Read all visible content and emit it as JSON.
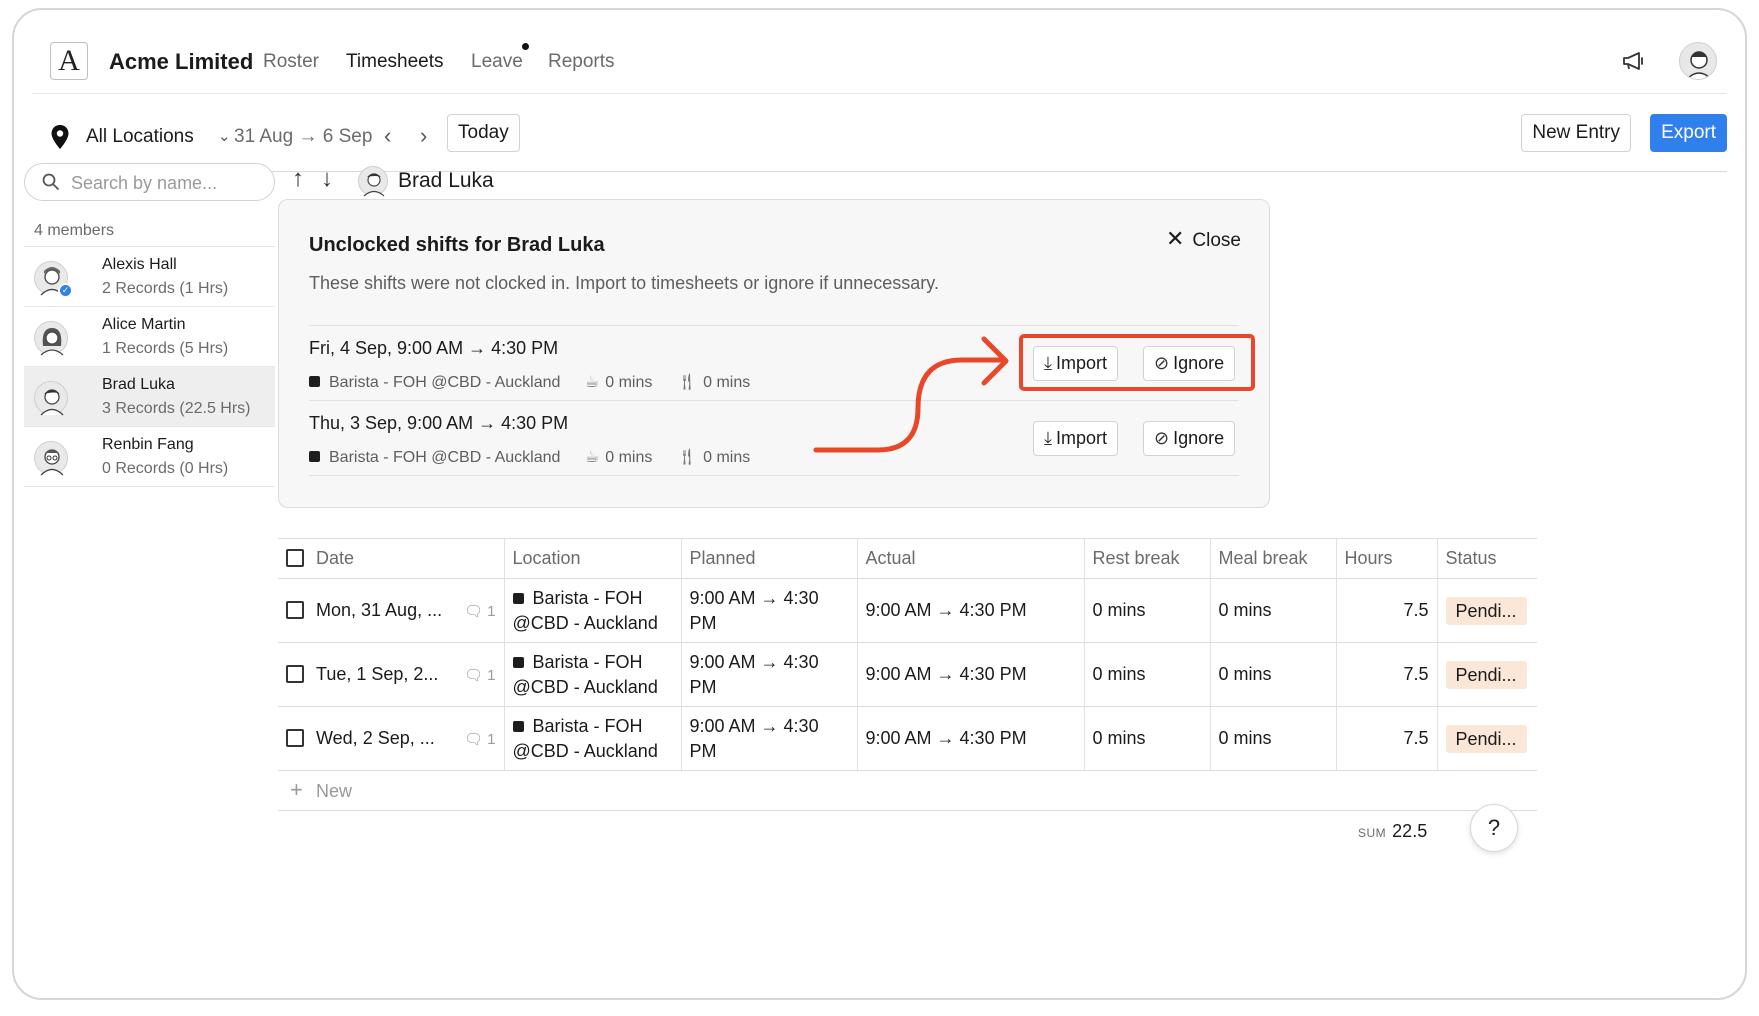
{
  "app": {
    "company": "Acme Limited",
    "logo_letter": "A"
  },
  "nav": {
    "items": [
      {
        "label": "Roster"
      },
      {
        "label": "Timesheets"
      },
      {
        "label": "Leave"
      },
      {
        "label": "Reports"
      }
    ],
    "active": "Timesheets"
  },
  "toolbar": {
    "location": "All Locations",
    "date_range": "31 Aug → 6 Sep",
    "prev": "‹",
    "next": "›",
    "today": "Today",
    "new_entry": "New Entry",
    "export": "Export",
    "accent_color": "#2f80ed"
  },
  "sidebar": {
    "search_placeholder": "Search by name...",
    "members_count": "4 members",
    "members": [
      {
        "name": "Alexis Hall",
        "records": "2 Records (1 Hrs)",
        "verified": true
      },
      {
        "name": "Alice Martin",
        "records": "1 Records (5 Hrs)"
      },
      {
        "name": "Brad Luka",
        "records": "3 Records (22.5 Hrs)",
        "selected": true
      },
      {
        "name": "Renbin Fang",
        "records": "0 Records (0 Hrs)"
      }
    ]
  },
  "employee": {
    "name": "Brad Luka",
    "up": "↑",
    "down": "↓"
  },
  "unclocked": {
    "title": "Unclocked shifts for Brad Luka",
    "subtitle": "These shifts were not clocked in. Import to timesheets or ignore if unnecessary.",
    "close_label": "Close",
    "shifts": [
      {
        "when": "Fri, 4 Sep, 9:00 AM → 4:30 PM",
        "location": "Barista - FOH @CBD - Auckland",
        "rest": "0 mins",
        "meal": "0 mins",
        "import": "Import",
        "ignore": "Ignore"
      },
      {
        "when": "Thu, 3 Sep, 9:00 AM → 4:30 PM",
        "location": "Barista - FOH @CBD - Auckland",
        "rest": "0 mins",
        "meal": "0 mins",
        "import": "Import",
        "ignore": "Ignore"
      }
    ],
    "highlight_color": "#e8472a"
  },
  "table": {
    "headers": {
      "date": "Date",
      "location": "Location",
      "planned": "Planned",
      "actual": "Actual",
      "rest": "Rest break",
      "meal": "Meal break",
      "hours": "Hours",
      "status": "Status"
    },
    "rows": [
      {
        "date": "Mon, 31 Aug, ...",
        "comments": "1",
        "location_line1": "Barista - FOH",
        "location_line2": "@CBD - Auckland",
        "planned_line1": "9:00 AM → 4:30",
        "planned_line2": "PM",
        "actual": "9:00 AM → 4:30 PM",
        "rest": "0 mins",
        "meal": "0 mins",
        "hours": "7.5",
        "status": "Pendi..."
      },
      {
        "date": "Tue, 1 Sep, 2...",
        "comments": "1",
        "location_line1": "Barista - FOH",
        "location_line2": "@CBD - Auckland",
        "planned_line1": "9:00 AM → 4:30",
        "planned_line2": "PM",
        "actual": "9:00 AM → 4:30 PM",
        "rest": "0 mins",
        "meal": "0 mins",
        "hours": "7.5",
        "status": "Pendi..."
      },
      {
        "date": "Wed, 2 Sep, ...",
        "comments": "1",
        "location_line1": "Barista - FOH",
        "location_line2": "@CBD - Auckland",
        "planned_line1": "9:00 AM → 4:30",
        "planned_line2": "PM",
        "actual": "9:00 AM → 4:30 PM",
        "rest": "0 mins",
        "meal": "0 mins",
        "hours": "7.5",
        "status": "Pendi..."
      }
    ],
    "new_row": "New",
    "sum_label": "SUM",
    "sum_value": "22.5",
    "status_color": "#fbe7d8"
  },
  "help": {
    "label": "?"
  }
}
